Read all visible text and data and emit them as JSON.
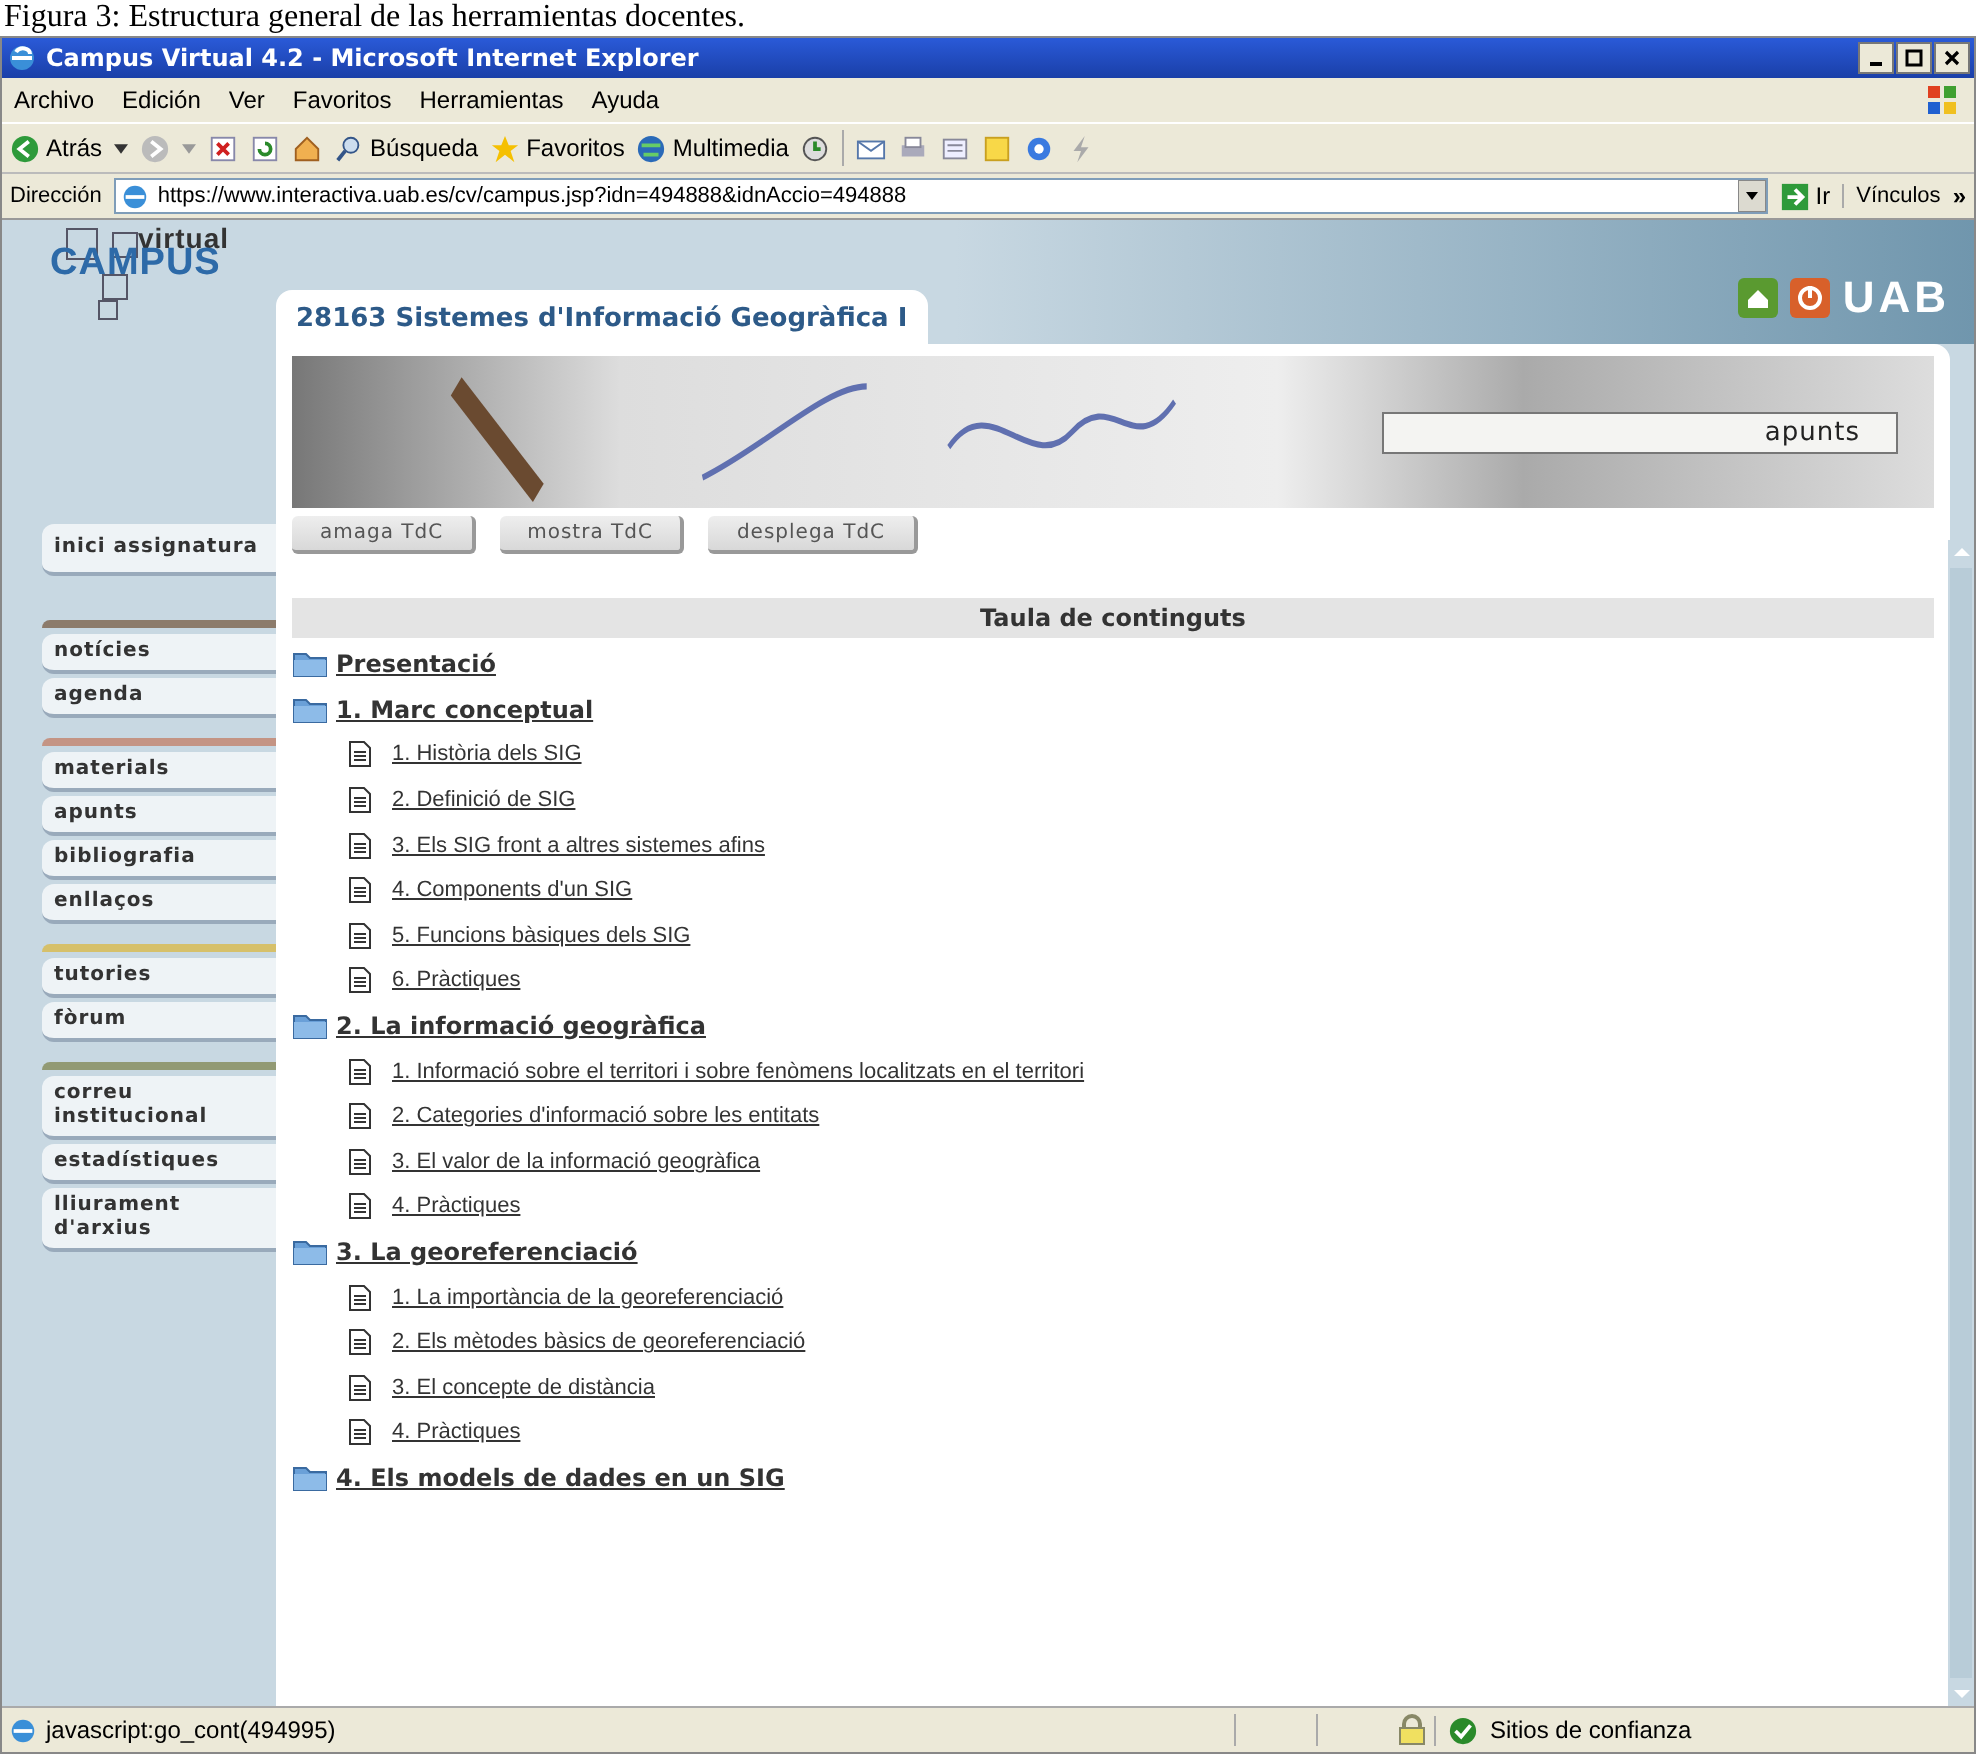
{
  "caption": "Figura 3: Estructura general de las herramientas docentes.",
  "window": {
    "title": "Campus Virtual 4.2 - Microsoft Internet Explorer"
  },
  "menu": [
    "Archivo",
    "Edición",
    "Ver",
    "Favoritos",
    "Herramientas",
    "Ayuda"
  ],
  "toolbar": [
    {
      "label": "Atrás"
    },
    {
      "label": "Búsqueda"
    },
    {
      "label": "Favoritos"
    },
    {
      "label": "Multimedia"
    }
  ],
  "address": {
    "label": "Dirección",
    "value": "https://www.interactiva.uab.es/cv/campus.jsp?idn=494888&idnAccio=494888",
    "go": "Ir",
    "links": "Vínculos",
    "more": "»"
  },
  "logo": {
    "top": "virtual",
    "main": "CAMPUS"
  },
  "course_title": "28163 Sistemes d'Informació Geogràfica I",
  "banner_label": "apunts",
  "brand": "UAB",
  "sidebar": {
    "home": "inici assignatura",
    "groups": [
      {
        "color": "#8c7b6b",
        "items": [
          "notícies",
          "agenda"
        ]
      },
      {
        "color": "#c49484",
        "items": [
          "materials",
          "apunts",
          "bibliografia",
          "enllaços"
        ]
      },
      {
        "color": "#d6c06a",
        "items": [
          "tutories",
          "fòrum"
        ]
      },
      {
        "color": "#929a74",
        "items": [
          "correu institucional",
          "estadístiques",
          "lliurament d'arxius"
        ]
      }
    ]
  },
  "toc_buttons": [
    "amaga TdC",
    "mostra TdC",
    "desplega TdC"
  ],
  "toc": {
    "title": "Taula de continguts",
    "sections": [
      {
        "label": "Presentació"
      },
      {
        "label": "1. Marc conceptual",
        "children": [
          "1. Història dels SIG",
          "2. Definició de SIG",
          "3. Els SIG front a altres sistemes afins",
          "4. Components d'un SIG",
          "5. Funcions bàsiques dels SIG",
          "6. Pràctiques"
        ]
      },
      {
        "label": "2. La informació geogràfica",
        "children": [
          "1. Informació sobre el territori i sobre fenòmens localitzats en el territori",
          "2. Categories d'informació sobre les entitats",
          "3. El valor de la informació geogràfica",
          "4. Pràctiques"
        ]
      },
      {
        "label": "3. La georeferenciació",
        "children": [
          "1. La importància de la georeferenciació",
          "2. Els mètodes bàsics de georeferenciació",
          "3. El concepte de distància",
          "4. Pràctiques"
        ]
      },
      {
        "label": "4. Els models de dades en un SIG"
      }
    ]
  },
  "status_bar": {
    "text": "javascript:go_cont(494995)",
    "zone": "Sitios de confianza"
  }
}
